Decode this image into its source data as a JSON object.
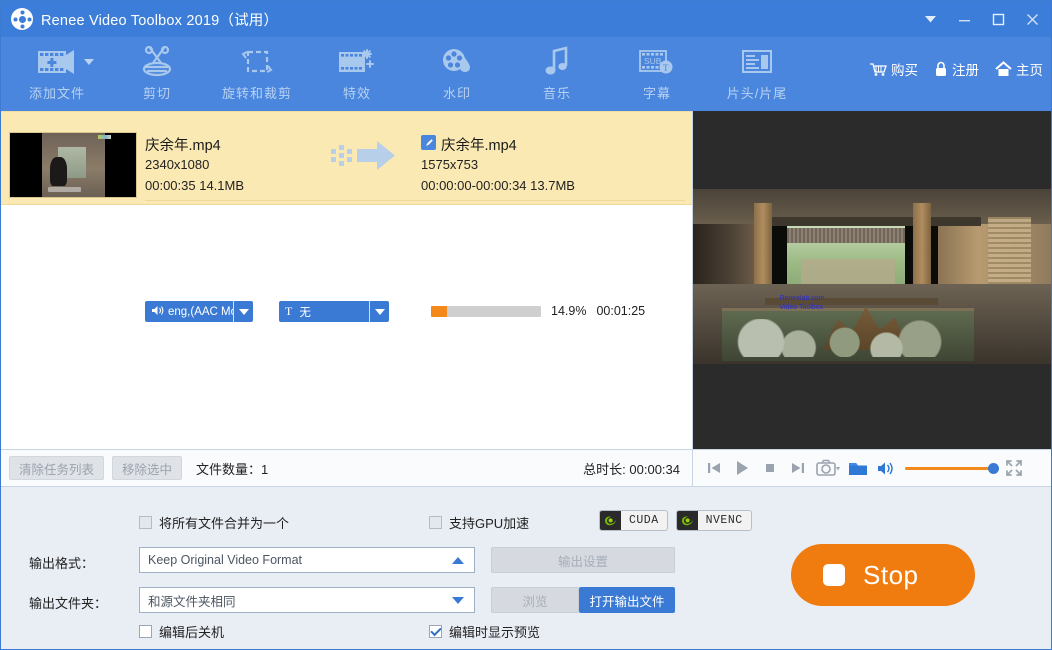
{
  "window": {
    "title": "Renee Video Toolbox 2019（试用）",
    "logo_icon": "film-reel-icon",
    "controls": [
      {
        "name": "dropdown-menu-button",
        "icon": "chevron-down-icon"
      },
      {
        "name": "minimize-button",
        "icon": "minimize-icon"
      },
      {
        "name": "maximize-button",
        "icon": "maximize-icon"
      },
      {
        "name": "close-button",
        "icon": "close-icon"
      }
    ]
  },
  "toolbar": {
    "items": [
      {
        "label": "添加文件",
        "icon": "add-file-icon",
        "has_caret": true
      },
      {
        "label": "剪切",
        "icon": "scissors-icon",
        "has_caret": false
      },
      {
        "label": "旋转和裁剪",
        "icon": "rotate-crop-icon",
        "has_caret": false
      },
      {
        "label": "特效",
        "icon": "effects-icon",
        "has_caret": false
      },
      {
        "label": "水印",
        "icon": "watermark-icon",
        "has_caret": false
      },
      {
        "label": "音乐",
        "icon": "music-note-icon",
        "has_caret": false
      },
      {
        "label": "字幕",
        "icon": "subtitle-icon",
        "has_caret": false
      },
      {
        "label": "片头/片尾",
        "icon": "intro-outro-icon",
        "has_caret": false
      }
    ],
    "right_links": [
      {
        "label": "购买",
        "icon": "cart-icon"
      },
      {
        "label": "注册",
        "icon": "lock-icon"
      },
      {
        "label": "主页",
        "icon": "home-icon"
      }
    ]
  },
  "task": {
    "source": {
      "name": "庆余年.mp4",
      "resolution": "2340x1080",
      "meta": "00:00:35  14.1MB"
    },
    "destination": {
      "name": "庆余年.mp4",
      "resolution": "1575x753",
      "meta": "00:00:00-00:00:34  13.7MB",
      "edit_icon": "pencil-edit-icon"
    },
    "audio_track": {
      "label": "eng,(AAC Mor",
      "icon": "speaker-icon"
    },
    "subtitle_track": {
      "label": "无",
      "icon": "subtitle-t-icon"
    },
    "progress": {
      "percent_label": "14.9%",
      "percent_value": 14.9,
      "eta": "00:01:25",
      "fill_color": "#f3891a"
    },
    "arrow_icon": "convert-arrow-icon"
  },
  "statusbar": {
    "clear_list_button": "清除任务列表",
    "remove_selected_button": "移除选中",
    "file_count_label": "文件数量：",
    "file_count_value": "1",
    "total_duration_label": "总时长:",
    "total_duration_value": "00:00:34"
  },
  "player": {
    "controls": [
      {
        "name": "previous-button",
        "icon": "skip-previous-icon"
      },
      {
        "name": "play-button",
        "icon": "play-icon"
      },
      {
        "name": "stop-playback-button",
        "icon": "stop-square-icon"
      },
      {
        "name": "next-button",
        "icon": "skip-next-icon"
      },
      {
        "name": "snapshot-button",
        "icon": "camera-icon"
      },
      {
        "name": "open-folder-button",
        "icon": "folder-icon"
      },
      {
        "name": "volume-button",
        "icon": "speaker-icon"
      },
      {
        "name": "fullscreen-button",
        "icon": "fullscreen-icon"
      }
    ],
    "volume_value": 100,
    "watermark_text_1": "Reneelab.com",
    "watermark_text_2": "Video Toolbox"
  },
  "settings": {
    "merge_all_label": "将所有文件合并为一个",
    "merge_all_checked": false,
    "gpu_accel_label": "支持GPU加速",
    "gpu_accel_checked": false,
    "gpu_badges": [
      {
        "label": "CUDA",
        "icon": "nvidia-icon"
      },
      {
        "label": "NVENC",
        "icon": "nvidia-icon"
      }
    ],
    "output_format_label": "输出格式：",
    "output_format_value": "Keep Original Video Format",
    "output_settings_button": "输出设置",
    "output_folder_label": "输出文件夹：",
    "output_folder_value": "和源文件夹相同",
    "browse_button": "浏览",
    "open_output_button": "打开输出文件",
    "shutdown_label": "编辑后关机",
    "shutdown_checked": false,
    "show_preview_label": "编辑时显示预览",
    "show_preview_checked": true
  },
  "action": {
    "stop_label": "Stop",
    "stop_icon": "stop-square-icon",
    "stop_color": "#f07c10"
  }
}
